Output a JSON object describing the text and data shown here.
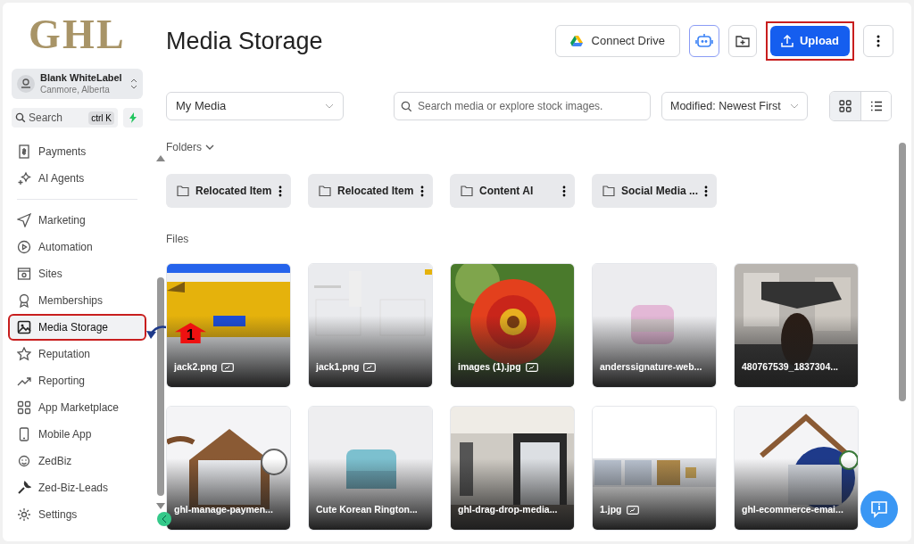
{
  "sidebar": {
    "logo": "GHL",
    "account": {
      "name": "Blank WhiteLabel",
      "location": "Canmore, Alberta"
    },
    "search": {
      "placeholder": "Search",
      "shortcut": "ctrl K"
    },
    "top_items": [
      {
        "label": "Payments",
        "selected": false
      },
      {
        "label": "AI Agents",
        "selected": false
      }
    ],
    "items": [
      {
        "label": "Marketing",
        "selected": false
      },
      {
        "label": "Automation",
        "selected": false
      },
      {
        "label": "Sites",
        "selected": false
      },
      {
        "label": "Memberships",
        "selected": false
      },
      {
        "label": "Media Storage",
        "selected": true
      },
      {
        "label": "Reputation",
        "selected": false
      },
      {
        "label": "Reporting",
        "selected": false
      },
      {
        "label": "App Marketplace",
        "selected": false
      },
      {
        "label": "Mobile App",
        "selected": false
      },
      {
        "label": "ZedBiz",
        "selected": false
      },
      {
        "label": "Zed-Biz-Leads",
        "selected": false
      },
      {
        "label": "Settings",
        "selected": false
      }
    ]
  },
  "annotation": {
    "marker": "1"
  },
  "header": {
    "title": "Media Storage",
    "connect_drive": "Connect Drive",
    "upload": "Upload"
  },
  "filters": {
    "source": "My Media",
    "search_placeholder": "Search media or explore stock images.",
    "sort": "Modified: Newest First",
    "view": [
      {
        "kind": "grid",
        "selected": true
      },
      {
        "kind": "list",
        "selected": false
      }
    ]
  },
  "folders_label": "Folders",
  "folders": [
    "Relocated Item",
    "Relocated Item",
    "Content AI",
    "Social Media ..."
  ],
  "files_label": "Files",
  "files": [
    {
      "name": "jack2.png",
      "image_badge": true
    },
    {
      "name": "jack1.png",
      "image_badge": true
    },
    {
      "name": "images (1).jpg",
      "image_badge": true
    },
    {
      "name": "anderssignature-web...",
      "image_badge": false
    },
    {
      "name": "480767539_1837304...",
      "image_badge": false
    },
    {
      "name": "ghl-manage-paymen...",
      "image_badge": false
    },
    {
      "name": "Cute Korean Rington...",
      "image_badge": false
    },
    {
      "name": "ghl-drag-drop-media...",
      "image_badge": false
    },
    {
      "name": "1.jpg",
      "image_badge": true
    },
    {
      "name": "ghl-ecommerce-emai...",
      "image_badge": false
    }
  ]
}
